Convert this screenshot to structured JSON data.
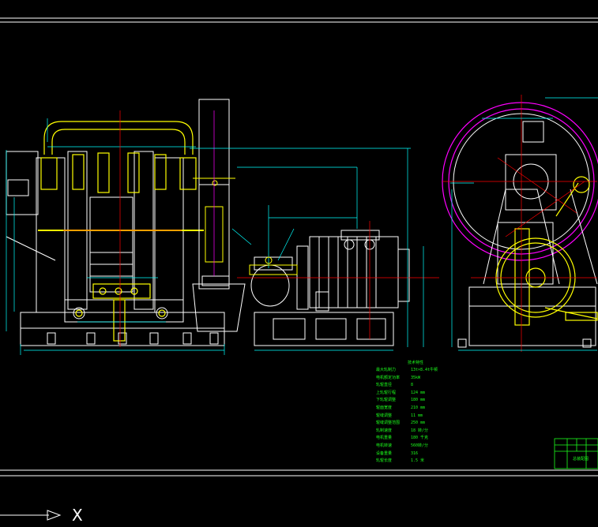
{
  "drawing": {
    "spec_table": {
      "title": "技术特性",
      "rows": [
        {
          "key": "最大轧制力",
          "value": "13t×8.4t牛顿"
        },
        {
          "key": "电机额定功率",
          "value": "35kW"
        },
        {
          "key": "轧辊直径",
          "value": "8"
        },
        {
          "key": "上轧辊行程",
          "value": "124 mm"
        },
        {
          "key": "下轧辊调整",
          "value": "180 mm"
        },
        {
          "key": "辊面宽度",
          "value": "210 mm"
        },
        {
          "key": "辊缝调整",
          "value": "11 mm"
        },
        {
          "key": "辊缝调整范围",
          "value": "250 mm"
        },
        {
          "key": "轧制速度",
          "value": "18 转/分"
        },
        {
          "key": "电机重量",
          "value": "180 千克"
        },
        {
          "key": "电机转速",
          "value": "560转/分"
        },
        {
          "key": "设备重量",
          "value": "316"
        },
        {
          "key": "轧辊长度",
          "value": "1.5 米"
        }
      ]
    },
    "title_block": {
      "label": "总装配图"
    },
    "ucs_axis_label": "X",
    "colors": {
      "background": "#000000",
      "frame": "#ffffff",
      "outline": "#ffffff",
      "component": "#ffff00",
      "dimension": "#00ffff",
      "centerline": "#ff0000",
      "hidden": "#ff00ff",
      "text": "#1cff1c"
    }
  }
}
